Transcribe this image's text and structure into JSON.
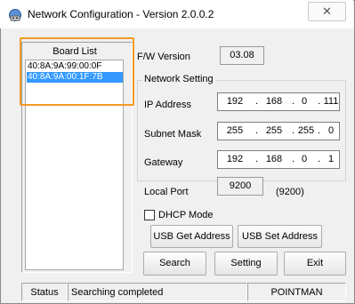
{
  "window": {
    "title": "Network Configuration - Version 2.0.0.2",
    "close_glyph": "✕"
  },
  "board_list": {
    "title": "Board List",
    "items": [
      "40:8A:9A:99:00:0F",
      "40:8A:9A:00:1F:7B"
    ],
    "selected_index": 1
  },
  "firmware": {
    "label": "F/W Version",
    "value": "03.08"
  },
  "network": {
    "group_label": "Network Setting",
    "ip": {
      "label": "IP Address",
      "octets": [
        "192",
        "168",
        "0",
        "111"
      ]
    },
    "subnet": {
      "label": "Subnet Mask",
      "octets": [
        "255",
        "255",
        "255",
        "0"
      ]
    },
    "gateway": {
      "label": "Gateway",
      "octets": [
        "192",
        "168",
        "0",
        "1"
      ]
    },
    "port": {
      "label": "Local Port",
      "value": "9200",
      "note": "(9200)"
    }
  },
  "dhcp": {
    "label": "DHCP Mode",
    "checked": false
  },
  "buttons": {
    "usb_get": "USB Get Address",
    "usb_set": "USB Set Address",
    "search": "Search",
    "setting": "Setting",
    "exit": "Exit"
  },
  "status": {
    "label": "Status",
    "message": "Searching completed",
    "brand": "POINTMAN"
  },
  "icons": {
    "app": "network-globe-icon",
    "close": "close-icon"
  },
  "colors": {
    "selection": "#3399ff",
    "highlight": "#f59a23"
  }
}
